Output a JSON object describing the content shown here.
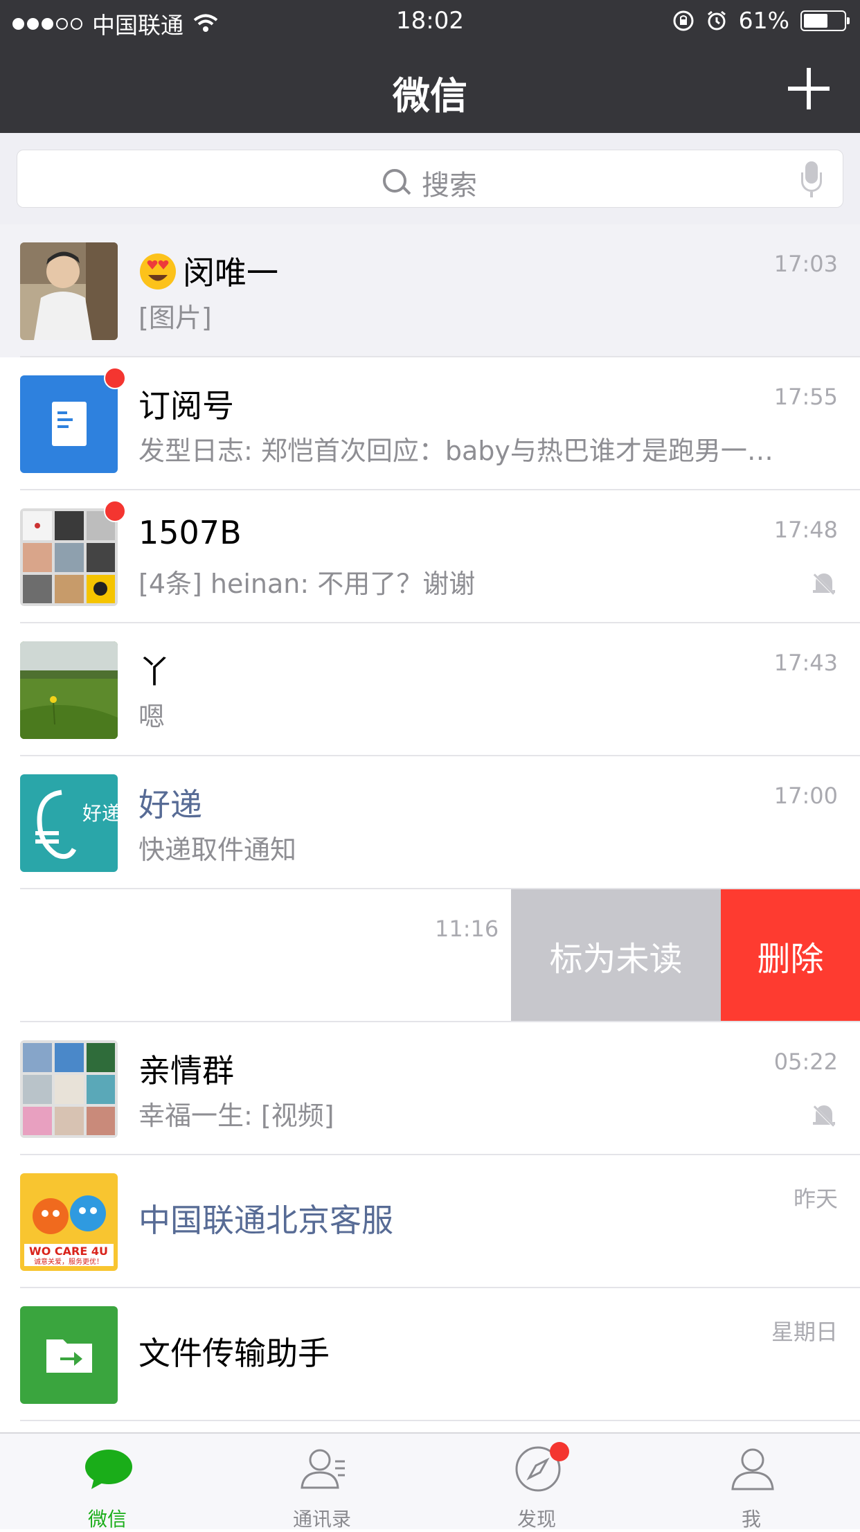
{
  "status_bar": {
    "carrier": "中国联通",
    "time": "18:02",
    "battery_text": "61%",
    "battery_level": 0.61,
    "signal_bars_filled": 3,
    "signal_bars_total": 5
  },
  "nav": {
    "title": "微信"
  },
  "search": {
    "placeholder": "搜索"
  },
  "chats": [
    {
      "name": "闵唯一",
      "preview": "[图片]",
      "time": "17:03",
      "pinned": true,
      "emoji": "heart-eyes"
    },
    {
      "name": "订阅号",
      "preview": "发型日志: 郑恺首次回应：baby与热巴谁才是跑男一…",
      "time": "17:55",
      "unread_dot": true
    },
    {
      "name": "1507B",
      "preview": "[4条] heinan: 不用了？谢谢",
      "time": "17:48",
      "unread_dot": true,
      "muted": true
    },
    {
      "name": "丫",
      "preview": "嗯",
      "time": "17:43"
    },
    {
      "name": "好递",
      "preview": "快递取件通知",
      "time": "17:00",
      "official": true
    },
    {
      "name": "",
      "preview": "",
      "time": "11:16",
      "swiped": true
    },
    {
      "name": "亲情群",
      "preview": "幸福一生: [视频]",
      "time": "05:22",
      "muted": true
    },
    {
      "name": "中国联通北京客服",
      "preview": "",
      "time": "昨天",
      "official": true
    },
    {
      "name": "文件传输助手",
      "preview": "",
      "time": "星期日"
    }
  ],
  "swipe_actions": {
    "mark_unread": "标为未读",
    "delete": "删除"
  },
  "avatar_text": {
    "haodi": "好递",
    "unicom_brand": "WO CARE 4U",
    "unicom_slogan": "诚意关爱，服务更优！"
  },
  "tabs": [
    {
      "label": "微信",
      "active": true
    },
    {
      "label": "通讯录"
    },
    {
      "label": "发现",
      "badge_dot": true
    },
    {
      "label": "我"
    }
  ],
  "colors": {
    "header_bg": "#36363a",
    "accent_green": "#1aad19",
    "delete_red": "#fe3b30",
    "mark_unread_gray": "#c7c7cc",
    "unread_dot": "#f43530",
    "official_name": "#576b95"
  }
}
